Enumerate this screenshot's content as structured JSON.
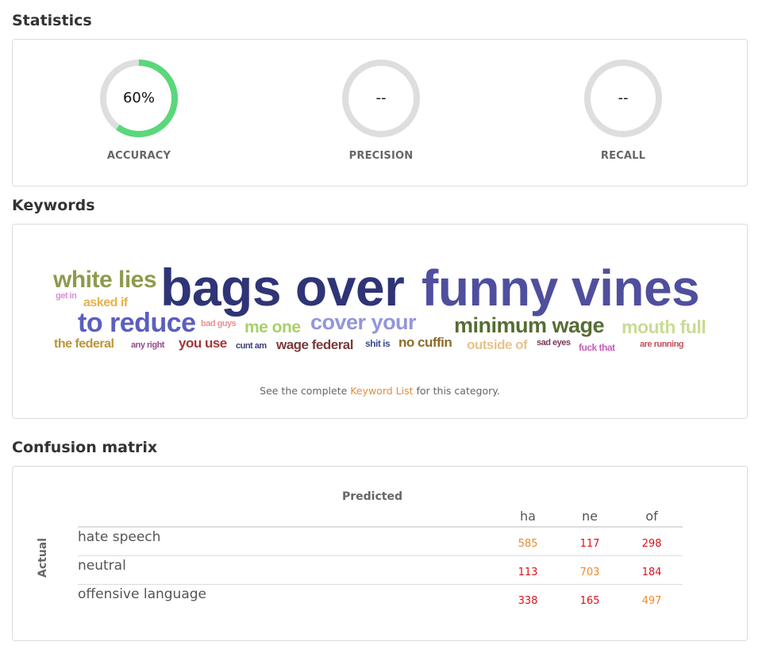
{
  "statistics": {
    "title": "Statistics",
    "items": [
      {
        "label": "ACCURACY",
        "value": "60%",
        "fraction": 0.6,
        "color": "#5bd77b"
      },
      {
        "label": "PRECISION",
        "value": "--",
        "fraction": 0,
        "color": "#5bd77b"
      },
      {
        "label": "RECALL",
        "value": "--",
        "fraction": 0,
        "color": "#5bd77b"
      }
    ],
    "track_color": "#dedede"
  },
  "keywords": {
    "title": "Keywords",
    "words": [
      {
        "text": "white lies",
        "color": "#8f9a4d"
      },
      {
        "text": "bags over",
        "color": "#2f3476"
      },
      {
        "text": "funny vines",
        "color": "#4f4f9e"
      },
      {
        "text": "get in",
        "color": "#d98ed8"
      },
      {
        "text": "asked if",
        "color": "#e6b14c"
      },
      {
        "text": "to reduce",
        "color": "#5b5fbf"
      },
      {
        "text": "bad guys",
        "color": "#e79290"
      },
      {
        "text": "me one",
        "color": "#a9d06a"
      },
      {
        "text": "cover your",
        "color": "#9396d8"
      },
      {
        "text": "minimum wage",
        "color": "#566d33"
      },
      {
        "text": "mouth full",
        "color": "#c8dc93"
      },
      {
        "text": "the federal",
        "color": "#b8963b"
      },
      {
        "text": "any right",
        "color": "#9a4b8c"
      },
      {
        "text": "you use",
        "color": "#a03838"
      },
      {
        "text": "cunt am",
        "color": "#3b3f7a"
      },
      {
        "text": "wage federal",
        "color": "#7b3a3a"
      },
      {
        "text": "shit is",
        "color": "#3b4a8c"
      },
      {
        "text": "no cuffin",
        "color": "#8c6d2a"
      },
      {
        "text": "outside of",
        "color": "#e6c48c"
      },
      {
        "text": "sad eyes",
        "color": "#7a3a5a"
      },
      {
        "text": "fuck that",
        "color": "#c75fb8"
      },
      {
        "text": "are running",
        "color": "#c4505a"
      }
    ],
    "footer_prefix": "See the complete ",
    "footer_link": "Keyword List",
    "footer_suffix": " for this category."
  },
  "confusion_matrix": {
    "title": "Confusion matrix",
    "predicted_label": "Predicted",
    "actual_label": "Actual",
    "columns": [
      "ha",
      "ne",
      "of"
    ],
    "rows": [
      {
        "label": "hate speech",
        "values": [
          "585",
          "117",
          "298"
        ]
      },
      {
        "label": "neutral",
        "values": [
          "113",
          "703",
          "184"
        ]
      },
      {
        "label": "offensive language",
        "values": [
          "338",
          "165",
          "497"
        ]
      }
    ],
    "diagonal_color": "#f08a2c",
    "offdiagonal_color": "#e0101a"
  }
}
